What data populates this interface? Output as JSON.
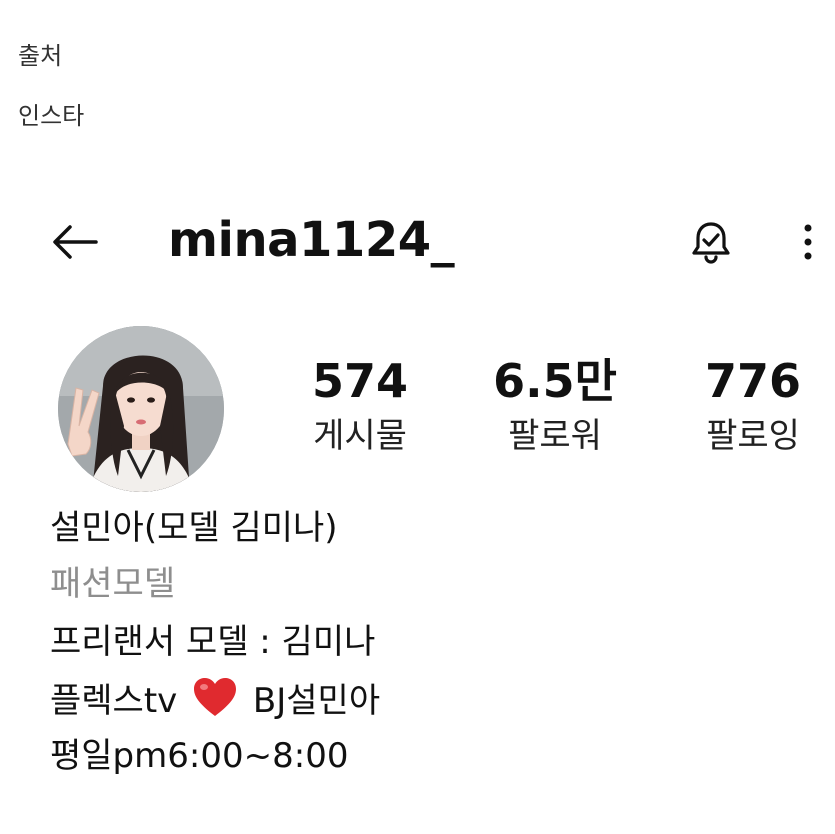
{
  "caption": {
    "source_label": "출처",
    "source_value": "인스타"
  },
  "header": {
    "username": "mina1124_"
  },
  "stats": [
    {
      "value": "574",
      "label": "게시물"
    },
    {
      "value": "6.5만",
      "label": "팔로워"
    },
    {
      "value": "776",
      "label": "팔로잉"
    }
  ],
  "bio": {
    "name": "설민아(모델 김미나)",
    "category": "패션모델",
    "line1": "프리랜서 모델 : 김미나",
    "line2_before": "플렉스tv",
    "line2_after": "BJ설민아",
    "line3": "평일pm6:00~8:00"
  },
  "icons": {
    "back": "arrow-left-icon",
    "notify": "bell-check-icon",
    "more": "vertical-dots-icon",
    "heart": "red-heart-emoji"
  },
  "colors": {
    "text": "#111111",
    "muted": "#8e8e8e",
    "heart": "#e02a2f"
  }
}
